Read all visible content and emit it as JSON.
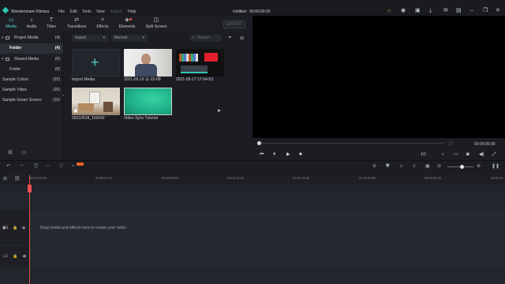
{
  "app": {
    "title": "Wondershare Filmora",
    "document_title": "Untitled : 00:00:00:00",
    "menu": [
      "File",
      "Edit",
      "Tools",
      "View",
      "Export",
      "Help"
    ],
    "menu_disabled": [
      "Export"
    ]
  },
  "toolbar": {
    "tabs": [
      {
        "label": "Media",
        "icon": "folder-icon",
        "active": true
      },
      {
        "label": "Audio",
        "icon": "music-note-icon"
      },
      {
        "label": "Titles",
        "icon": "text-icon"
      },
      {
        "label": "Transitions",
        "icon": "transitions-icon"
      },
      {
        "label": "Effects",
        "icon": "effects-icon"
      },
      {
        "label": "Elements",
        "icon": "elements-icon"
      },
      {
        "label": "Split Screen",
        "icon": "split-screen-icon"
      }
    ],
    "export_label": "EXPORT"
  },
  "sidebar": {
    "items": [
      {
        "label": "Project Media",
        "count": "(4)"
      },
      {
        "label": "Folder",
        "count": "(4)",
        "selected": true
      },
      {
        "label": "Shared Media",
        "count": "(0)"
      },
      {
        "label": "Folder",
        "count": "(0)"
      },
      {
        "label": "Sample Colors",
        "count": "(25)"
      },
      {
        "label": "Sample Video",
        "count": "(20)"
      },
      {
        "label": "Sample Green Screen",
        "count": "(10)"
      }
    ]
  },
  "media": {
    "import_label": "Import",
    "record_label": "Record",
    "search_placeholder": "Search",
    "items": [
      {
        "label": "Import Media"
      },
      {
        "label": "2021-05-19 11-22-08"
      },
      {
        "label": "2021-05-17 17-54-53"
      },
      {
        "label": "20210518_162042"
      },
      {
        "label": "Video Sync Tutorial"
      }
    ]
  },
  "preview": {
    "timecode": "00:00:00:00",
    "ratio": "1/2",
    "progress": 0
  },
  "timeline": {
    "ticks": [
      "00:00:00:00",
      "00:00:04:10",
      "00:00:08:20",
      "00:00:12:30",
      "00:00:16:40",
      "00:00:20:50",
      "00:00:25:00",
      "00:00:29"
    ],
    "drop_hint": "Drag media and effects here to create your video."
  },
  "colors": {
    "accent": "#5fd6e1",
    "playhead": "#e85151",
    "green_screen": "#1fae86"
  }
}
